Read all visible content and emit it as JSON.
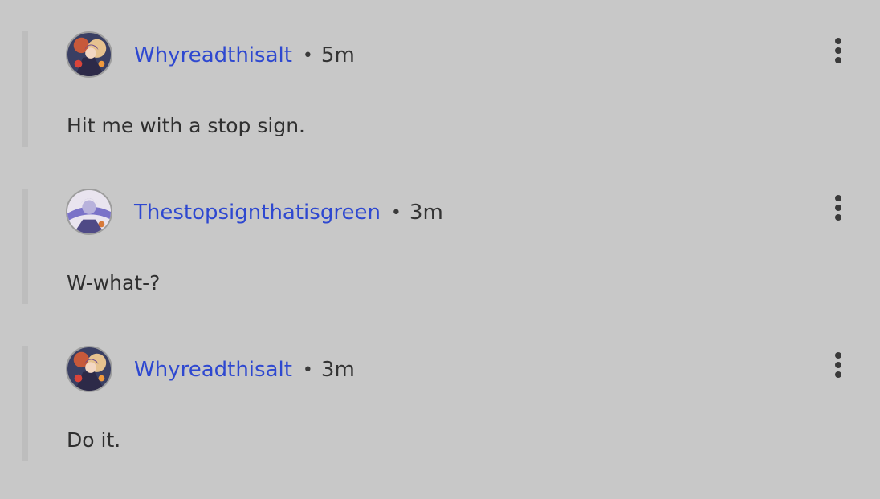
{
  "comments": [
    {
      "username": "Whyreadthisalt",
      "separator": "•",
      "time": "5m",
      "text": "Hit me with a stop sign.",
      "avatar_icon": "anime-character-avatar-icon"
    },
    {
      "username": "Thestopsignthatisgreen",
      "separator": "•",
      "time": "3m",
      "text": "W-what-?",
      "avatar_icon": "anime-character-avatar-icon"
    },
    {
      "username": "Whyreadthisalt",
      "separator": "•",
      "time": "3m",
      "text": "Do it.",
      "avatar_icon": "anime-character-avatar-icon"
    }
  ],
  "colors": {
    "background": "#c8c8c8",
    "username": "#2e48d0",
    "text": "#2f2f2f",
    "rail": "#bdbdbd"
  },
  "icons": {
    "menu": "vertical-ellipsis-icon"
  }
}
